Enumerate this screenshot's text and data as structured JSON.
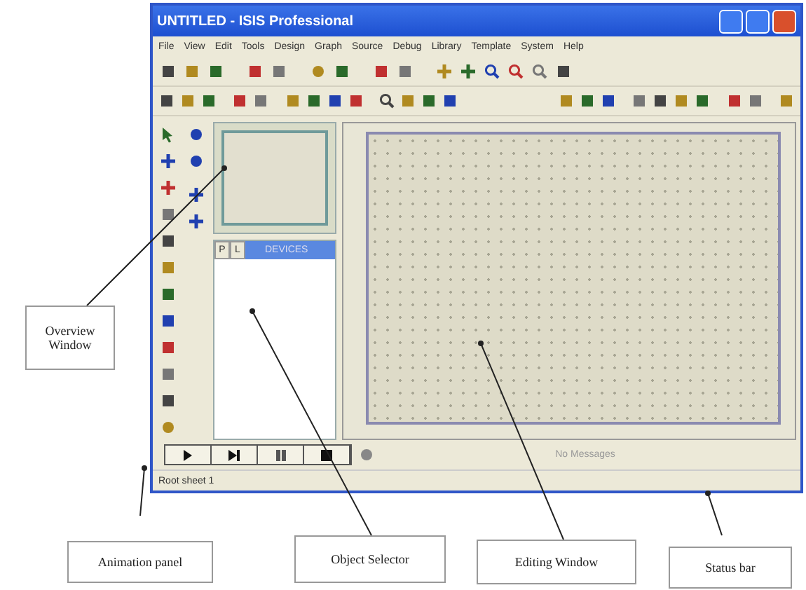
{
  "window": {
    "title": "UNTITLED - ISIS Professional"
  },
  "menu": [
    "File",
    "View",
    "Edit",
    "Tools",
    "Design",
    "Graph",
    "Source",
    "Debug",
    "Library",
    "Template",
    "System",
    "Help"
  ],
  "object_selector": {
    "buttons": [
      "P",
      "L"
    ],
    "title": "DEVICES"
  },
  "animation_panel": {
    "message": "No Messages"
  },
  "status_bar": {
    "text": "Root sheet 1"
  },
  "callouts": [
    {
      "label": "Overview Window"
    },
    {
      "label": "Animation panel"
    },
    {
      "label": "Object Selector"
    },
    {
      "label": "Editing Window"
    },
    {
      "label": "Status bar"
    }
  ]
}
